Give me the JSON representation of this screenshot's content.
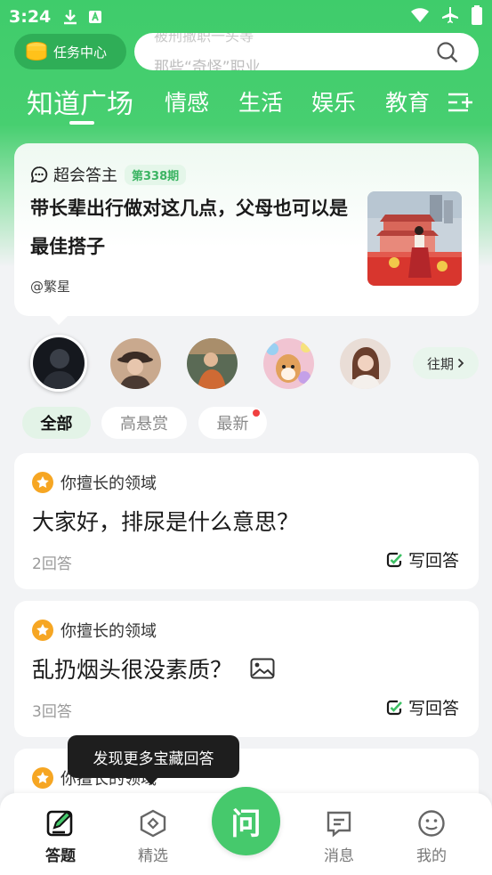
{
  "status_bar": {
    "time": "3:24"
  },
  "header": {
    "task_center_label": "任务中心",
    "search_hint_top": "被刑撤职一头等",
    "search_hint": "那些“奇怪”职业"
  },
  "tabs": [
    {
      "label": "知道广场",
      "active": true
    },
    {
      "label": "情感"
    },
    {
      "label": "生活"
    },
    {
      "label": "娱乐"
    },
    {
      "label": "教育"
    }
  ],
  "hero": {
    "brand": "超会答主",
    "issue": "第338期",
    "title": "带长辈出行做对这几点，父母也可以是最佳搭子",
    "author": "@繁星"
  },
  "past_button_label": "往期",
  "filters": [
    {
      "label": "全部",
      "active": true
    },
    {
      "label": "高悬赏"
    },
    {
      "label": "最新",
      "dot": true
    }
  ],
  "questions": [
    {
      "domain": "你擅长的领域",
      "text": "大家好，排尿是什么意思？",
      "answers": "2回答",
      "action": "写回答",
      "has_image": false
    },
    {
      "domain": "你擅长的领域",
      "text": "乱扔烟头很没素质？",
      "answers": "3回答",
      "action": "写回答",
      "has_image": true
    },
    {
      "domain": "你擅长的领域"
    }
  ],
  "tooltip": "发现更多宝藏回答",
  "bottom_nav": {
    "answer": "答题",
    "featured": "精选",
    "ask": "问",
    "messages": "消息",
    "me": "我的"
  },
  "colors": {
    "brand_green": "#46c96c",
    "dark_green": "#2fae57",
    "badge_red": "#f04040",
    "star_orange": "#f6a623"
  }
}
